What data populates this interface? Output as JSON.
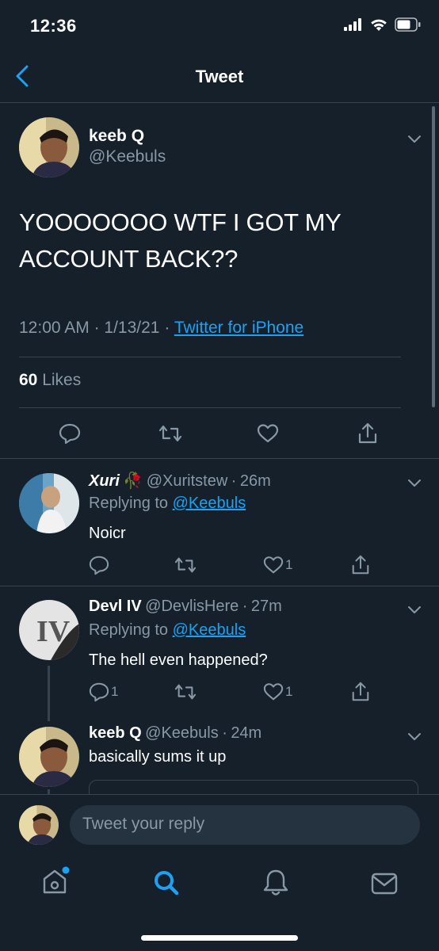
{
  "status_bar": {
    "time": "12:36"
  },
  "header": {
    "title": "Tweet"
  },
  "main_tweet": {
    "name": "keeb Q",
    "handle": "@Keebuls",
    "text": "YOOOOOOO WTF I GOT MY ACCOUNT BACK??",
    "time": "12:00 AM",
    "date": "1/13/21",
    "source": "Twitter for iPhone",
    "likes_count": "60",
    "likes_label": "Likes"
  },
  "replies": [
    {
      "name": "Xuri",
      "emoji": "🥀",
      "handle": "@Xuritstew",
      "age": "26m",
      "replying_label": "Replying to",
      "replying_to": "@Keebuls",
      "text": "Noicr",
      "reply_count": "",
      "like_count": "1"
    },
    {
      "name": "Devl IV",
      "handle": "@DevlisHere",
      "age": "27m",
      "replying_label": "Replying to",
      "replying_to": "@Keebuls",
      "text": "The hell even happened?",
      "reply_count": "1",
      "like_count": "1"
    },
    {
      "name": "keeb Q",
      "handle": "@Keebuls",
      "age": "24m",
      "text": "basically sums it up"
    }
  ],
  "reply_bar": {
    "placeholder": "Tweet your reply"
  },
  "separator": "·",
  "colors": {
    "background": "#15202b",
    "accent": "#1da1f2",
    "muted": "#8899a6",
    "border": "#38444d"
  }
}
